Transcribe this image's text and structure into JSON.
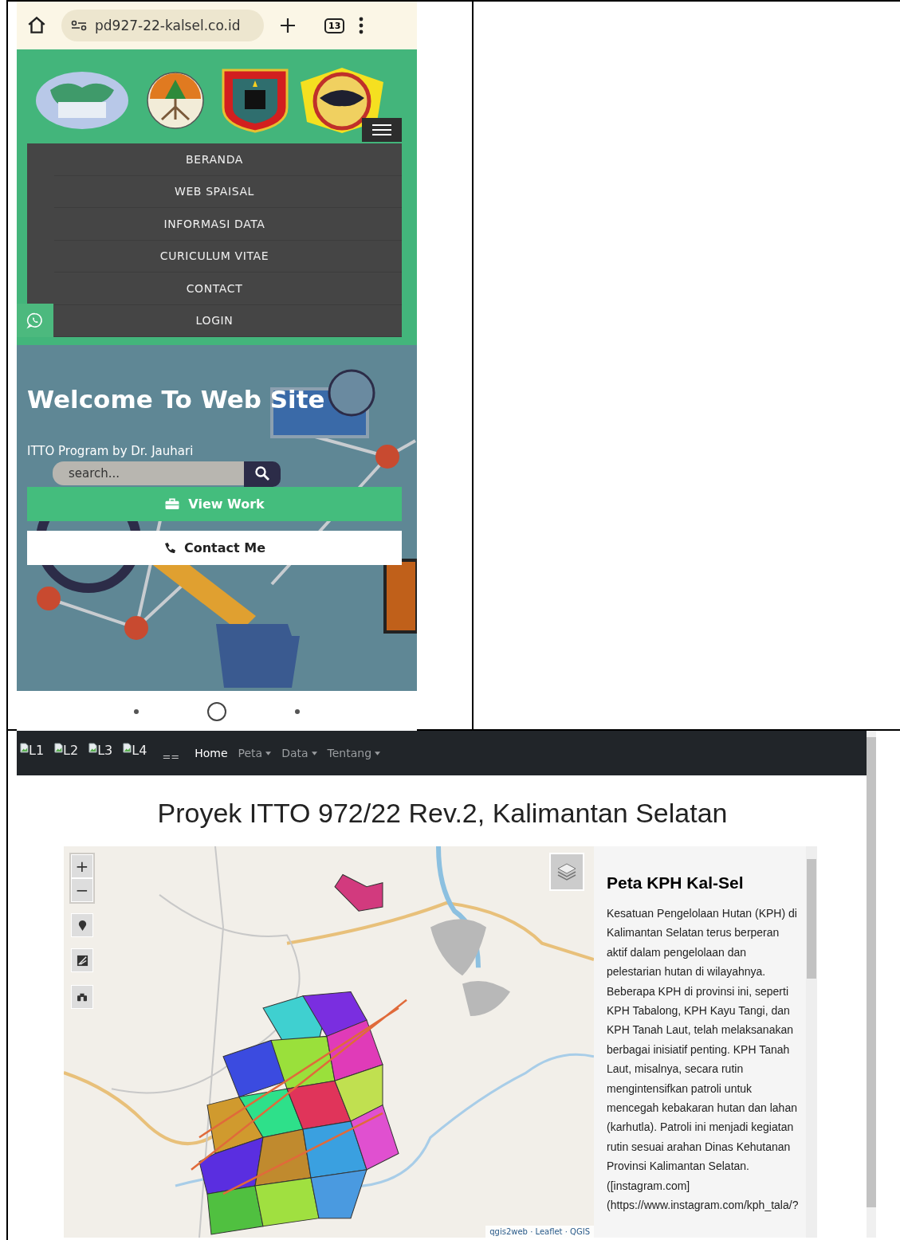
{
  "phone": {
    "browser": {
      "url": "pd927-22-kalsel.co.id",
      "tab_count": "13"
    },
    "menu": [
      {
        "label": "BERANDA"
      },
      {
        "label": "WEB SPAISAL"
      },
      {
        "label": "INFORMASI DATA"
      },
      {
        "label": "CURICULUM VITAE"
      },
      {
        "label": "CONTACT"
      },
      {
        "label": "LOGIN"
      }
    ],
    "hero": {
      "title": "Welcome To Web Site",
      "subtitle": "ITTO Program by Dr. Jauhari",
      "search": {
        "placeholder": "search..."
      },
      "buttons": [
        {
          "label": "View Work",
          "kind": "primary"
        },
        {
          "label": "Contact Me",
          "kind": "secondary"
        }
      ]
    }
  },
  "web": {
    "navbar": {
      "logos": [
        "L1",
        "L2",
        "L3",
        "L4"
      ],
      "toggler": "==",
      "links": [
        {
          "label": "Home",
          "dropdown": false,
          "selected": true
        },
        {
          "label": "Peta",
          "dropdown": true,
          "selected": false
        },
        {
          "label": "Data",
          "dropdown": true,
          "selected": false
        },
        {
          "label": "Tentang",
          "dropdown": true,
          "selected": false
        }
      ]
    },
    "title": "Proyek ITTO 972/22 Rev.2, Kalimantan Selatan",
    "map": {
      "zoom_in": "+",
      "zoom_out": "−",
      "attribution": "qgis2web · Leaflet · QGIS"
    },
    "panel": {
      "title": "Peta KPH Kal-Sel",
      "text": "Kesatuan Pengelolaan Hutan (KPH) di Kalimantan Selatan terus berperan aktif dalam pengelolaan dan pelestarian hutan di wilayahnya. Beberapa KPH di provinsi ini, seperti KPH Tabalong, KPH Kayu Tangi, dan KPH Tanah Laut, telah melaksanakan berbagai inisiatif penting. KPH Tanah Laut, misalnya, secara rutin mengintensifkan patroli untuk mencegah kebakaran hutan dan lahan (karhutla). Patroli ini menjadi kegiatan rutin sesuai arahan Dinas Kehutanan Provinsi Kalimantan Selatan. ([instagram.com] (https://www.instagram.com/kph_tala/?"
    }
  }
}
